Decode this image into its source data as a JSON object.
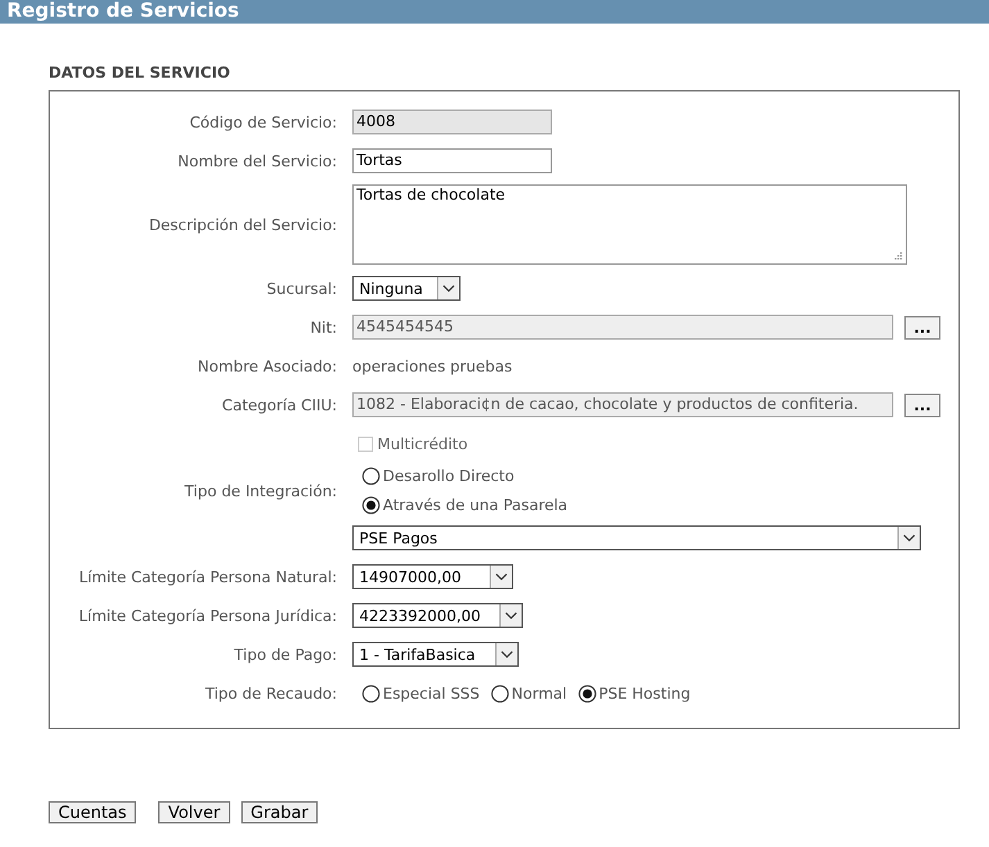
{
  "header": {
    "title": "Registro de Servicios"
  },
  "section": {
    "title": "DATOS DEL SERVICIO"
  },
  "fields": [
    {
      "kind": "input",
      "label": "Código de Servicio:",
      "value": "4008",
      "disabled": true
    },
    {
      "kind": "input",
      "label": "Nombre del Servicio:",
      "value": "Tortas",
      "disabled": false
    },
    {
      "kind": "textarea",
      "label": "Descripción del Servicio:",
      "value": "Tortas de chocolate"
    },
    {
      "kind": "select",
      "label": "Sucursal:",
      "value": "Ninguna"
    },
    {
      "kind": "lookup",
      "label": "Nit:",
      "value": "4545454545",
      "button": "..."
    },
    {
      "kind": "static",
      "label": "Nombre Asociado:",
      "value": "operaciones pruebas"
    },
    {
      "kind": "lookup",
      "label": "Categoría CIIU:",
      "value": "1082 - Elaboraci¢n de cacao, chocolate y productos de confiteria.",
      "button": "..."
    },
    {
      "kind": "checkbox",
      "text": "Multicrédito",
      "checked": false,
      "disabled": true
    },
    {
      "kind": "radios",
      "label": "Tipo de Integración:",
      "options": [
        {
          "text": "Desarollo Directo",
          "selected": false
        },
        {
          "text": "Através de una Pasarela",
          "selected": true
        }
      ]
    },
    {
      "kind": "select",
      "value": "PSE Pagos"
    },
    {
      "kind": "select",
      "label": "Límite Categoría Persona Natural:",
      "value": "14907000,00"
    },
    {
      "kind": "select",
      "label": "Límite Categoría Persona Jurídica:",
      "value": "4223392000,00"
    },
    {
      "kind": "select",
      "label": "Tipo de Pago:",
      "value": "1 - TarifaBasica"
    },
    {
      "kind": "radios",
      "label": "Tipo de Recaudo:",
      "options": [
        {
          "text": "Especial SSS",
          "selected": false
        },
        {
          "text": "Normal",
          "selected": false
        },
        {
          "text": "PSE Hosting",
          "selected": true
        }
      ]
    }
  ],
  "buttons": [
    "Cuentas",
    "Volver",
    "Grabar"
  ]
}
